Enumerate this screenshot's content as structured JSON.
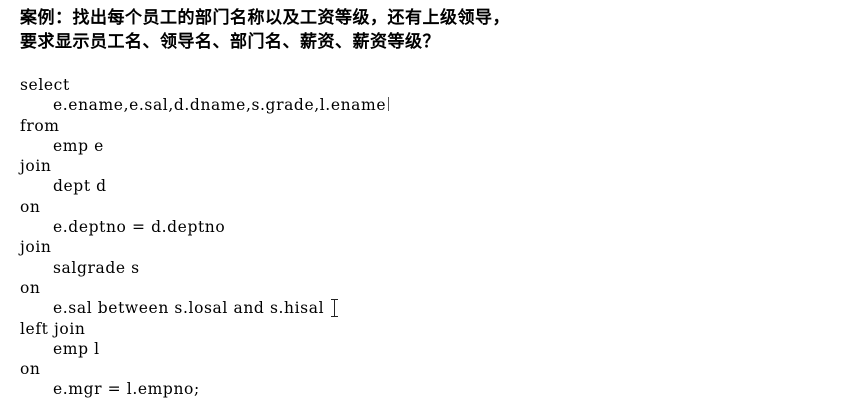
{
  "heading": {
    "line1": "案例：找出每个员工的部门名称以及工资等级，还有上级领导，",
    "line2": "要求显示员工名、领导名、部门名、薪资、薪资等级？"
  },
  "code": {
    "lines": [
      "select",
      "e.ename,e.sal,d.dname,s.grade,l.ename",
      "from",
      "emp e",
      "join",
      "dept d",
      "on",
      "e.deptno = d.deptno",
      "join",
      "salgrade s",
      "on",
      "e.sal between s.losal and s.hisal",
      "left join",
      "emp l",
      "on",
      "e.mgr = l.empno;"
    ]
  }
}
